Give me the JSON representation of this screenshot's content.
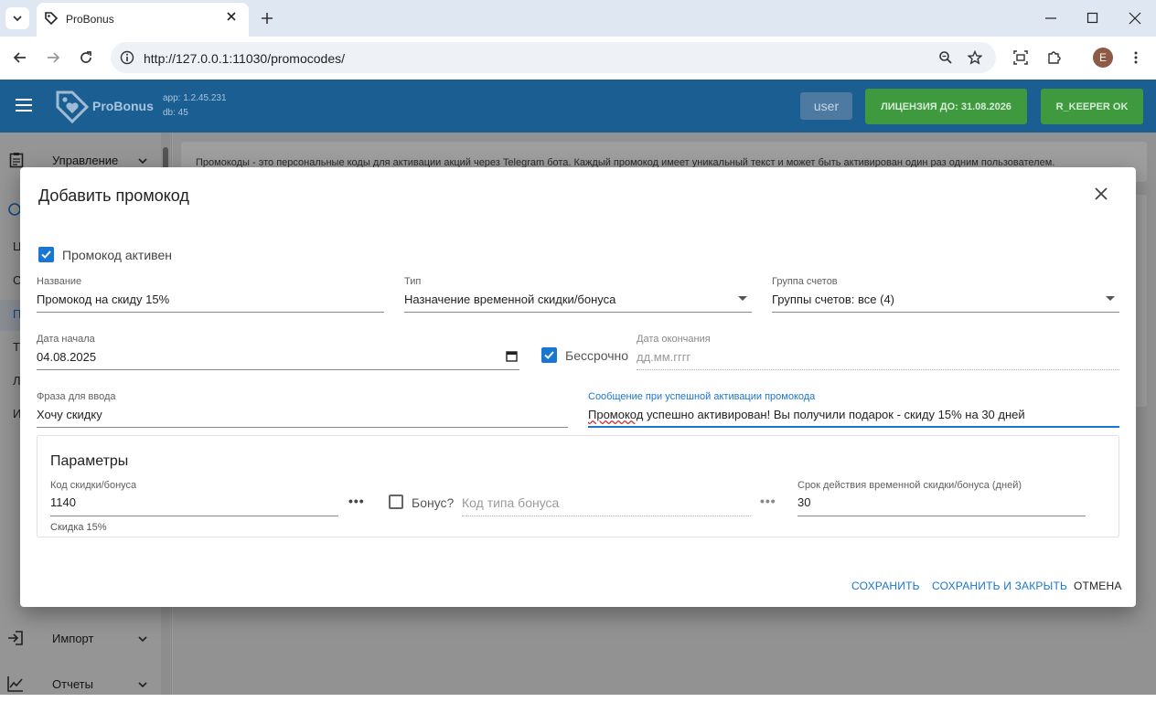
{
  "browser": {
    "tab_title": "ProBonus",
    "url": "http://127.0.0.1:11030/promocodes/",
    "profile_initial": "E"
  },
  "app": {
    "logo_text": "ProBonus",
    "version_app": "app: 1.2.45.231",
    "version_db": "db: 45",
    "user_button": "user",
    "license_button": "ЛИЦЕНЗИЯ ДО: 31.08.2026",
    "rkeeper_button": "R_KEEPER OK",
    "colors": {
      "header": "#1b5e91",
      "license": "#3f9a3f",
      "accent": "#1976d2"
    }
  },
  "sidebar": {
    "items": [
      {
        "label": "Управление",
        "icon": "clipboard-icon"
      },
      {
        "label": "Импорт",
        "icon": "import-icon"
      },
      {
        "label": "Отчеты",
        "icon": "chart-icon"
      }
    ],
    "partial_letters": [
      "Ц",
      "С",
      "П",
      "Т",
      "Л",
      "И"
    ]
  },
  "background": {
    "info_text": "Промокоды - это персональные коды для активации акций через Telegram бота. Каждый промокод имеет уникальный текст и может быть активирован один раз одним пользователем."
  },
  "dialog": {
    "title": "Добавить промокод",
    "active_checkbox_label": "Промокод активен",
    "name": {
      "label": "Название",
      "value": "Промокод на скиду 15%"
    },
    "type": {
      "label": "Тип",
      "value": "Назначение временной скидки/бонуса"
    },
    "group": {
      "label": "Группа счетов",
      "value": "Группы счетов: все (4)"
    },
    "start_date": {
      "label": "Дата начала",
      "value": "04.08.2025"
    },
    "unlimited_label": "Бессрочно",
    "end_date": {
      "label": "Дата окончания",
      "placeholder": "дд.мм.гггг"
    },
    "phrase": {
      "label": "Фраза для ввода",
      "value": "Хочу скидку"
    },
    "message": {
      "label": "Сообщение при успешной активации промокода",
      "value_first": "Промокод",
      "value_rest": " успешно активирован! Вы получили подарок - скиду 15% на 30 дней"
    },
    "params": {
      "title": "Параметры",
      "discount_code": {
        "label": "Код скидки/бонуса",
        "value": "1140",
        "helper": "Скидка 15%"
      },
      "bonus_label": "Бонус?",
      "bonus_type": {
        "placeholder": "Код типа бонуса"
      },
      "duration": {
        "label": "Срок действия временной скидки/бонуса (дней)",
        "value": "30"
      },
      "more_glyph": "•••"
    },
    "actions": {
      "save": "СОХРАНИТЬ",
      "save_close": "СОХРАНИТЬ И ЗАКРЫТЬ",
      "cancel": "ОТМЕНА"
    }
  }
}
